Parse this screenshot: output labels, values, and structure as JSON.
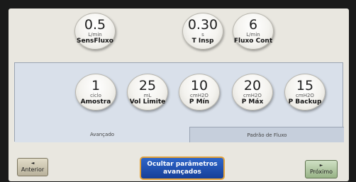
{
  "top_knobs": [
    {
      "value": "0.5",
      "unit": "L/min",
      "label": "SensFluxo"
    },
    {
      "value": "0.30",
      "unit": "s",
      "label": "T Insp"
    },
    {
      "value": "6",
      "unit": "L/min",
      "label": "Fluxo Cont"
    }
  ],
  "panel_knobs": [
    {
      "value": "1",
      "unit": "ciclo",
      "label": "Amostra"
    },
    {
      "value": "25",
      "unit": "mL",
      "label": "Vol Limite"
    },
    {
      "value": "10",
      "unit": "cmH2O",
      "label": "P Mín"
    },
    {
      "value": "20",
      "unit": "cmH2O",
      "label": "P Máx"
    },
    {
      "value": "15",
      "unit": "cmH2O",
      "label": "P Backup"
    }
  ],
  "tabs": {
    "advanced": "Avançado",
    "flow_pattern": "Padrão de Fluxo"
  },
  "nav": {
    "previous": "Anterior",
    "next": "Próximo",
    "arrow_left": "◄",
    "arrow_right": "►"
  },
  "hide_button": {
    "line1": "Ocultar parâmetros",
    "line2": "avançados"
  }
}
